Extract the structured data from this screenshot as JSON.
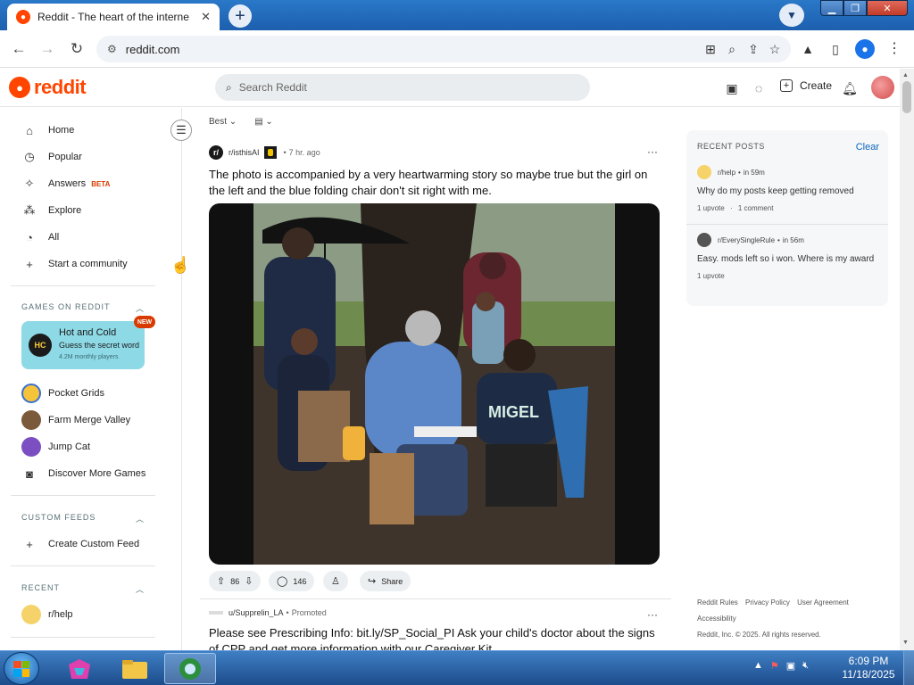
{
  "browser": {
    "tab_title": "Reddit - The heart of the interne",
    "tab_close": "✕",
    "new_tab": "+",
    "url": "reddit.com",
    "colors": {
      "titlebar": "#1c5fae",
      "toolbar": "#ffffff"
    }
  },
  "header": {
    "logo_text": "reddit",
    "search_placeholder": "Search Reddit",
    "create_label": "Create",
    "brand_color": "#ff4500"
  },
  "sidebar": {
    "nav": [
      {
        "label": "Home",
        "icon": "home-icon"
      },
      {
        "label": "Popular",
        "icon": "popular-icon"
      },
      {
        "label": "Answers",
        "badge": "BETA",
        "icon": "answers-icon"
      },
      {
        "label": "Explore",
        "icon": "explore-icon"
      },
      {
        "label": "All",
        "icon": "all-icon"
      },
      {
        "label": "Start a community",
        "icon": "plus-icon"
      }
    ],
    "games_header": "GAMES ON REDDIT",
    "featured_game": {
      "title": "Hot and Cold",
      "subtitle": "Guess the secret word",
      "players": "4.2M monthly players",
      "badge": "NEW"
    },
    "games": [
      {
        "label": "Pocket Grids"
      },
      {
        "label": "Farm Merge Valley"
      },
      {
        "label": "Jump Cat"
      },
      {
        "label": "Discover More Games"
      }
    ],
    "custom_feeds_header": "CUSTOM FEEDS",
    "create_custom_feed": "Create Custom Feed",
    "recent_header": "RECENT",
    "recent": [
      {
        "label": "r/help"
      }
    ]
  },
  "feed": {
    "sort_label": "Best",
    "posts": [
      {
        "subreddit": "r/isthisAI",
        "time": "7 hr. ago",
        "title": "The photo is accompanied by a very heartwarming story so maybe true but the girl on the left and the blue folding chair don't sit right with me.",
        "shirt_text": "MIGEL",
        "votes": "86",
        "comments": "146",
        "share_label": "Share"
      },
      {
        "user": "u/Supprelin_LA",
        "promoted": "Promoted",
        "title": "Please see Prescribing Info: bit.ly/SP_Social_PI Ask your child's doctor about the signs of CPP and get more information with our Caregiver Kit."
      }
    ]
  },
  "recent_posts": {
    "header": "RECENT POSTS",
    "clear_label": "Clear",
    "items": [
      {
        "subreddit": "r/help",
        "time": "in 59m",
        "title": "Why do my posts keep getting removed",
        "upvotes": "1 upvote",
        "comments": "1 comment"
      },
      {
        "subreddit": "r/EverySingleRule",
        "time": "in 56m",
        "title": "Easy. mods left so i won. Where is my award",
        "upvotes": "1 upvote"
      }
    ]
  },
  "footer": {
    "links": [
      "Reddit Rules",
      "Privacy Policy",
      "User Agreement",
      "Accessibility"
    ],
    "copyright": "Reddit, Inc. © 2025. All rights reserved."
  },
  "taskbar": {
    "time": "6:09 PM",
    "date": "11/18/2025"
  }
}
